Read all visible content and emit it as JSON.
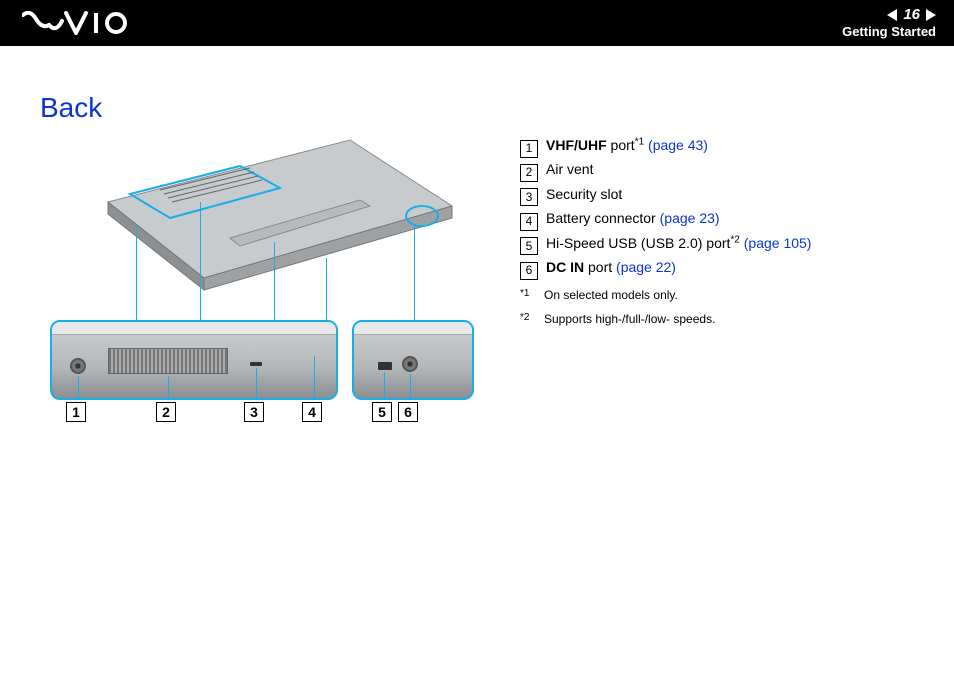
{
  "header": {
    "page_number": "16",
    "section": "Getting Started"
  },
  "title": "Back",
  "callouts": [
    {
      "num": "1",
      "bold": "VHF/UHF",
      "rest": " port",
      "sup": "*1",
      "link": "(page 43)"
    },
    {
      "num": "2",
      "bold": "",
      "rest": "Air vent",
      "sup": "",
      "link": ""
    },
    {
      "num": "3",
      "bold": "",
      "rest": "Security slot",
      "sup": "",
      "link": ""
    },
    {
      "num": "4",
      "bold": "",
      "rest": "Battery connector ",
      "sup": "",
      "link": "(page 23)"
    },
    {
      "num": "5",
      "bold": "",
      "rest": "Hi-Speed USB (USB 2.0) port",
      "sup": "*2",
      "link": "(page 105)"
    },
    {
      "num": "6",
      "bold": "DC IN",
      "rest": " port ",
      "sup": "",
      "link": "(page 22)"
    }
  ],
  "footnotes": [
    {
      "mark": "*1",
      "text": "On selected models only."
    },
    {
      "mark": "*2",
      "text": "Supports high-/full-/low- speeds."
    }
  ],
  "diagram_labels": {
    "n1": "1",
    "n2": "2",
    "n3": "3",
    "n4": "4",
    "n5": "5",
    "n6": "6"
  }
}
